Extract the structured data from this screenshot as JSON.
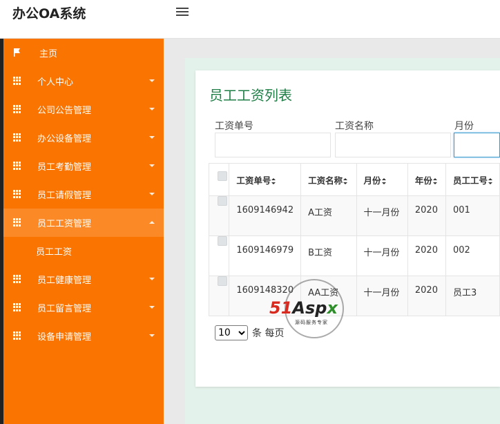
{
  "app": {
    "title": "办公OA系统"
  },
  "sidebar": {
    "items": [
      {
        "label": "主页",
        "icon": "flag-icon"
      },
      {
        "label": "个人中心",
        "icon": "grid-icon"
      },
      {
        "label": "公司公告管理",
        "icon": "grid-icon"
      },
      {
        "label": "办公设备管理",
        "icon": "grid-icon"
      },
      {
        "label": "员工考勤管理",
        "icon": "grid-icon"
      },
      {
        "label": "员工请假管理",
        "icon": "grid-icon"
      },
      {
        "label": "员工工资管理",
        "icon": "grid-icon",
        "expanded": true
      },
      {
        "label": "员工健康管理",
        "icon": "grid-icon"
      },
      {
        "label": "员工留言管理",
        "icon": "grid-icon"
      },
      {
        "label": "设备申请管理",
        "icon": "grid-icon"
      }
    ],
    "sub_item": {
      "label": "员工工资"
    }
  },
  "main": {
    "title": "员工工资列表",
    "filters": [
      {
        "label": "工资单号",
        "value": ""
      },
      {
        "label": "工资名称",
        "value": ""
      },
      {
        "label": "月份",
        "value": ""
      }
    ],
    "table": {
      "headers": [
        "工资单号",
        "工资名称",
        "月份",
        "年份",
        "员工工号"
      ],
      "rows": [
        [
          "1609146942",
          "A工资",
          "十一月份",
          "2020",
          "001"
        ],
        [
          "1609146979",
          "B工资",
          "十一月份",
          "2020",
          "002"
        ],
        [
          "1609148320",
          "AA工资",
          "十一月份",
          "2020",
          "员工3"
        ]
      ]
    },
    "pagination": {
      "page_size": "10",
      "per_page_label": "条 每页"
    }
  },
  "watermark": {
    "brand_red": "51",
    "brand_dark": "Asp",
    "brand_green": "x",
    "tagline": "源码服务专家"
  },
  "colors": {
    "sidebar": "#f97400",
    "sidebar_active": "#fb8a26",
    "title_green": "#1e7e45",
    "panel_mint": "#e3f2ea"
  }
}
